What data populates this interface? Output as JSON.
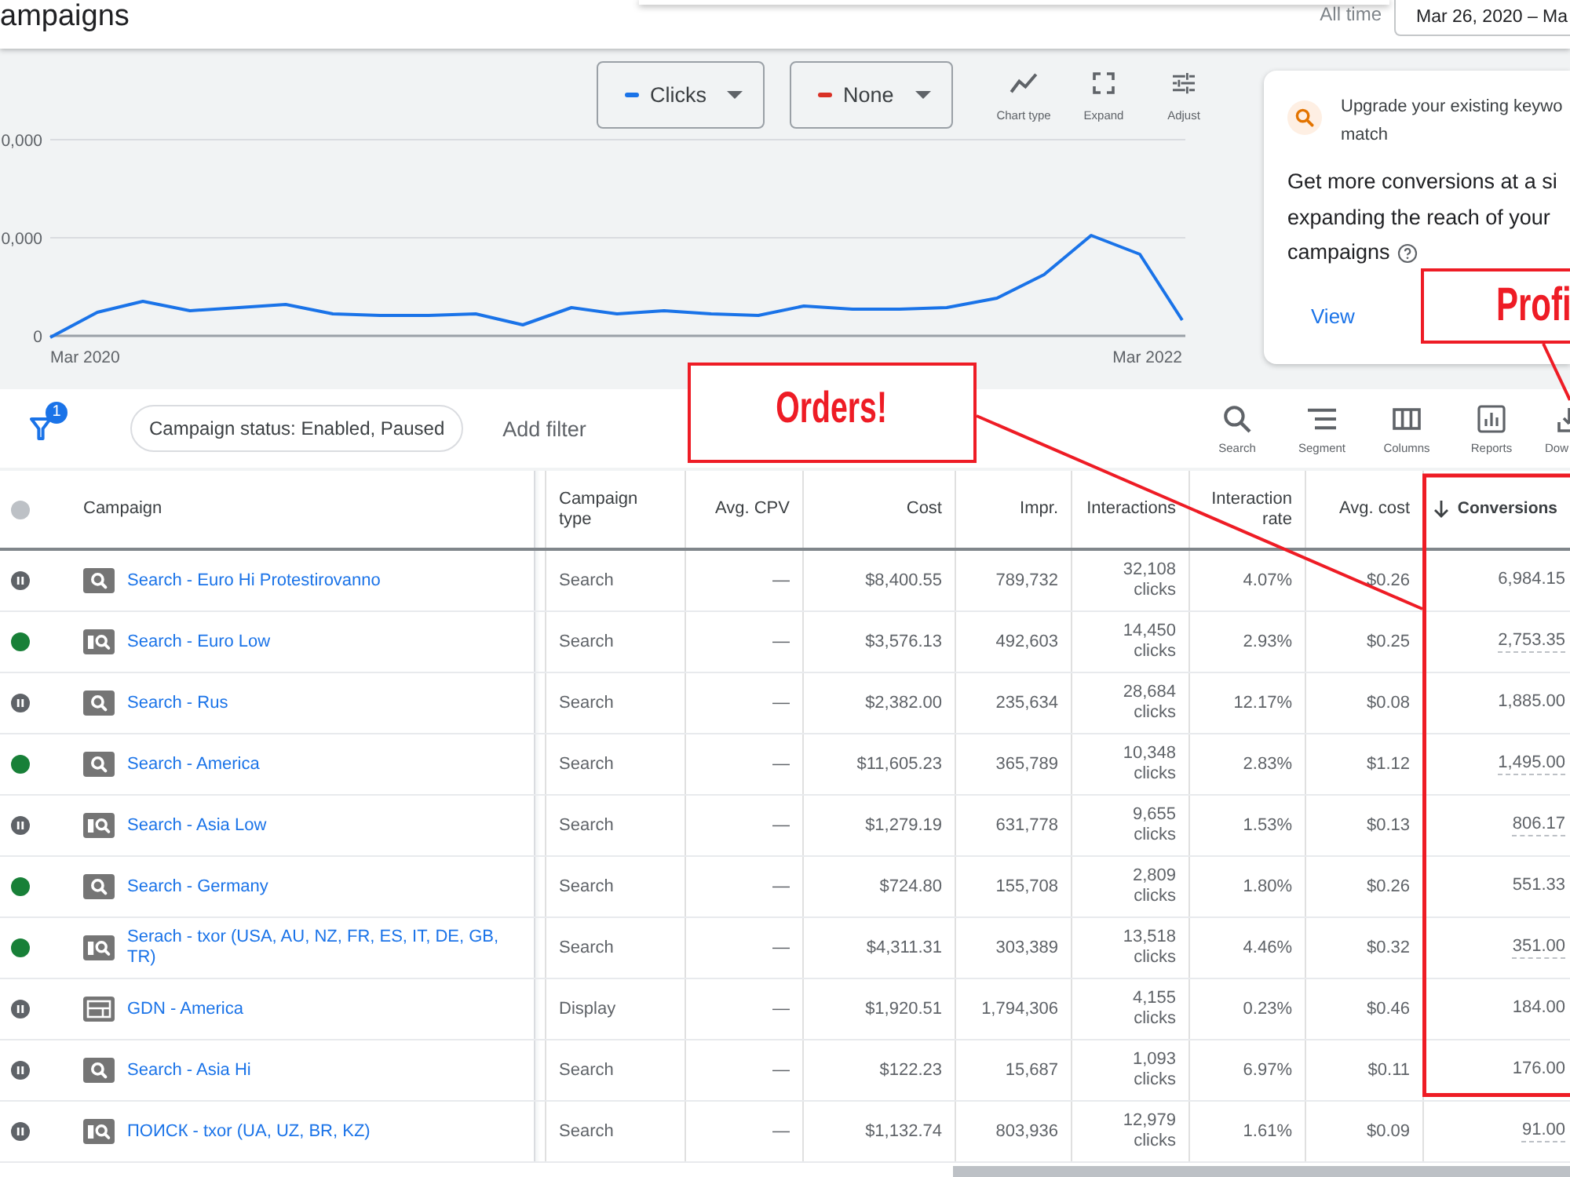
{
  "header": {
    "title": "ampaigns",
    "date_range_label": "All time",
    "date_range": "Mar 26, 2020 – Ma"
  },
  "chart": {
    "metrics": [
      {
        "label": "Clicks",
        "color": "#1a73e8"
      },
      {
        "label": "None",
        "color": "#d93025"
      }
    ],
    "tools": [
      {
        "label": "Chart type",
        "kind": "line"
      },
      {
        "label": "Expand",
        "kind": "expand"
      },
      {
        "label": "Adjust",
        "kind": "adjust"
      }
    ],
    "y_labels": [
      "0,000",
      "0,000",
      "0"
    ],
    "x_labels": [
      "Mar 2020",
      "Mar 2022"
    ]
  },
  "recommendation": {
    "heading_lines": [
      "Upgrade your existing keywo",
      "match"
    ],
    "body_lines": [
      "Get more conversions at a si",
      "expanding the reach of your",
      "campaigns"
    ],
    "action": "View"
  },
  "filter_bar": {
    "filter_count": "1",
    "chips": [
      "Campaign status: Enabled, Paused"
    ],
    "add_filter": "Add filter",
    "tools": [
      {
        "label": "Search",
        "kind": "search"
      },
      {
        "label": "Segment",
        "kind": "segment"
      },
      {
        "label": "Columns",
        "kind": "columns"
      },
      {
        "label": "Reports",
        "kind": "reports"
      },
      {
        "label": "Dow",
        "kind": "download"
      }
    ]
  },
  "table": {
    "columns": [
      {
        "label": "Campaign",
        "kind": "text",
        "sorted": false
      },
      {
        "label": "Campaign type",
        "kind": "text",
        "sorted": false
      },
      {
        "label": "Avg. CPV",
        "kind": "number",
        "sorted": false
      },
      {
        "label": "Cost",
        "kind": "number",
        "sorted": false
      },
      {
        "label": "Impr.",
        "kind": "number",
        "sorted": false
      },
      {
        "label": "Interactions",
        "kind": "number",
        "sorted": false
      },
      {
        "label": "Interaction rate",
        "kind": "number",
        "sorted": false
      },
      {
        "label": "Avg. cost",
        "kind": "number",
        "sorted": false
      },
      {
        "label": "Conversions",
        "kind": "number",
        "sorted": true
      }
    ],
    "rows": [
      {
        "kind": "search",
        "enabled": false,
        "name": "Search - Euro Hi Protestirovanno",
        "type": "Search",
        "avg_cpv": "—",
        "cost": "$8,400.55",
        "impr": "789,732",
        "interactions": "32,108 clicks",
        "interaction_rate": "4.07%",
        "avg_cost": "$0.26",
        "conversions": "6,984.15",
        "conversions_tooltip": false
      },
      {
        "kind": "search-panel",
        "enabled": true,
        "name": "Search - Euro Low",
        "type": "Search",
        "avg_cpv": "—",
        "cost": "$3,576.13",
        "impr": "492,603",
        "interactions": "14,450 clicks",
        "interaction_rate": "2.93%",
        "avg_cost": "$0.25",
        "conversions": "2,753.35",
        "conversions_tooltip": true
      },
      {
        "kind": "search",
        "enabled": false,
        "name": "Search - Rus",
        "type": "Search",
        "avg_cpv": "—",
        "cost": "$2,382.00",
        "impr": "235,634",
        "interactions": "28,684 clicks",
        "interaction_rate": "12.17%",
        "avg_cost": "$0.08",
        "conversions": "1,885.00",
        "conversions_tooltip": false
      },
      {
        "kind": "search",
        "enabled": true,
        "name": "Search - America",
        "type": "Search",
        "avg_cpv": "—",
        "cost": "$11,605.23",
        "impr": "365,789",
        "interactions": "10,348 clicks",
        "interaction_rate": "2.83%",
        "avg_cost": "$1.12",
        "conversions": "1,495.00",
        "conversions_tooltip": true
      },
      {
        "kind": "search-panel",
        "enabled": false,
        "name": "Search - Asia Low",
        "type": "Search",
        "avg_cpv": "—",
        "cost": "$1,279.19",
        "impr": "631,778",
        "interactions": "9,655 clicks",
        "interaction_rate": "1.53%",
        "avg_cost": "$0.13",
        "conversions": "806.17",
        "conversions_tooltip": true
      },
      {
        "kind": "search",
        "enabled": true,
        "name": "Search - Germany",
        "type": "Search",
        "avg_cpv": "—",
        "cost": "$724.80",
        "impr": "155,708",
        "interactions": "2,809 clicks",
        "interaction_rate": "1.80%",
        "avg_cost": "$0.26",
        "conversions": "551.33",
        "conversions_tooltip": false
      },
      {
        "kind": "search-panel",
        "enabled": true,
        "name": "Serach - txor (USA, AU, NZ, FR, ES, IT, DE, GB, TR)",
        "type": "Search",
        "avg_cpv": "—",
        "cost": "$4,311.31",
        "impr": "303,389",
        "interactions": "13,518 clicks",
        "interaction_rate": "4.46%",
        "avg_cost": "$0.32",
        "conversions": "351.00",
        "conversions_tooltip": true
      },
      {
        "kind": "display",
        "enabled": false,
        "name": "GDN - America",
        "type": "Display",
        "avg_cpv": "—",
        "cost": "$1,920.51",
        "impr": "1,794,306",
        "interactions": "4,155 clicks",
        "interaction_rate": "0.23%",
        "avg_cost": "$0.46",
        "conversions": "184.00",
        "conversions_tooltip": false
      },
      {
        "kind": "search",
        "enabled": false,
        "name": "Search - Asia Hi",
        "type": "Search",
        "avg_cpv": "—",
        "cost": "$122.23",
        "impr": "15,687",
        "interactions": "1,093 clicks",
        "interaction_rate": "6.97%",
        "avg_cost": "$0.11",
        "conversions": "176.00",
        "conversions_tooltip": false
      },
      {
        "kind": "search-panel",
        "enabled": false,
        "name": "ПОИСК - txor (UA, UZ, BR, KZ)",
        "type": "Search",
        "avg_cpv": "—",
        "cost": "$1,132.74",
        "impr": "803,936",
        "interactions": "12,979 clicks",
        "interaction_rate": "1.61%",
        "avg_cost": "$0.09",
        "conversions": "91.00",
        "conversions_tooltip": true
      }
    ]
  },
  "annotations": [
    {
      "kind": "callout",
      "text": "Orders!"
    },
    {
      "kind": "callout",
      "text": "Profi"
    }
  ]
}
